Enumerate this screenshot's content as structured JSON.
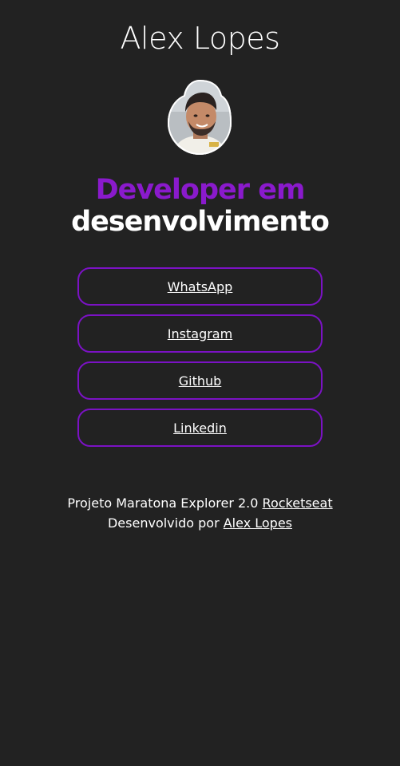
{
  "profile": {
    "name": "Alex Lopes",
    "headline_accent": "Developer em",
    "headline_rest": "desenvolvimento",
    "avatar_alt": "Foto de Alex Lopes"
  },
  "links": [
    {
      "label": "WhatsApp"
    },
    {
      "label": "Instagram"
    },
    {
      "label": "Github"
    },
    {
      "label": "Linkedin"
    }
  ],
  "footer": {
    "line1_text": "Projeto Maratona Explorer 2.0",
    "line1_link": "Rocketseat",
    "line2_text": "Desenvolvido por",
    "line2_link": "Alex Lopes"
  },
  "colors": {
    "background": "#222222",
    "accent": "#8a1acc",
    "button_border": "#7b12c4",
    "text": "#ffffff"
  }
}
